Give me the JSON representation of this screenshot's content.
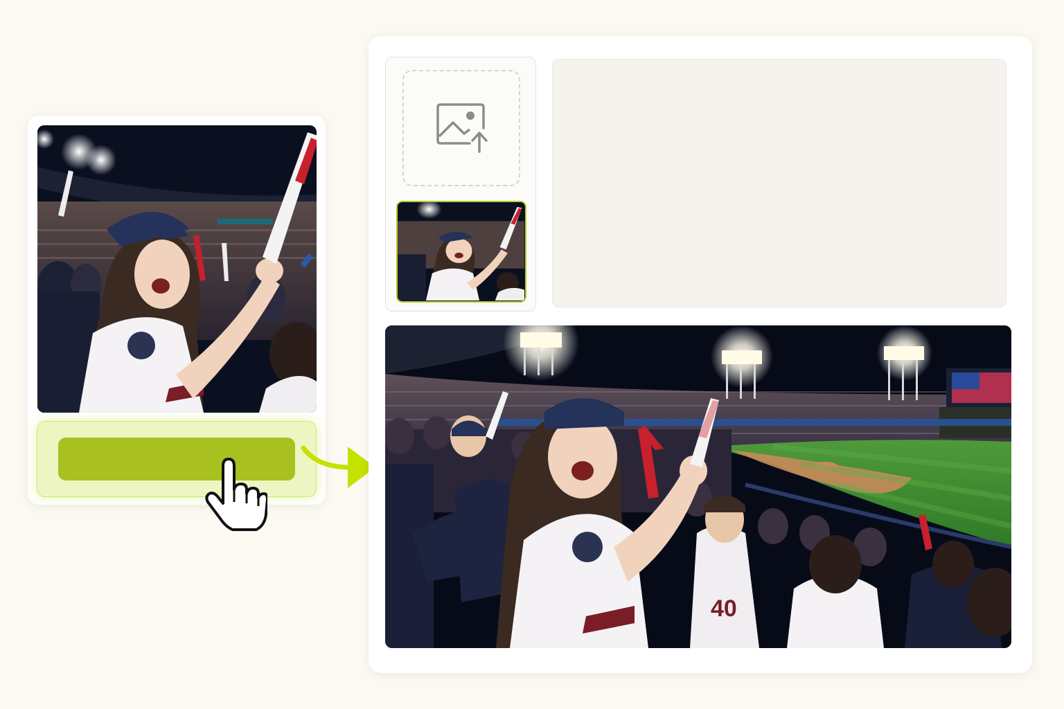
{
  "colors": {
    "page_background": "#fbf9f2",
    "card_background": "#ffffff",
    "accent_green": "#a8c020",
    "accent_highlight": "#edf6c2",
    "prompt_background": "#f5f3ee"
  },
  "icons": {
    "upload": "image-upload-icon",
    "cursor": "hand-pointer-icon",
    "arrow": "curved-arrow-icon"
  },
  "generate_button": {
    "label": ""
  },
  "prompt": {
    "value": ""
  }
}
